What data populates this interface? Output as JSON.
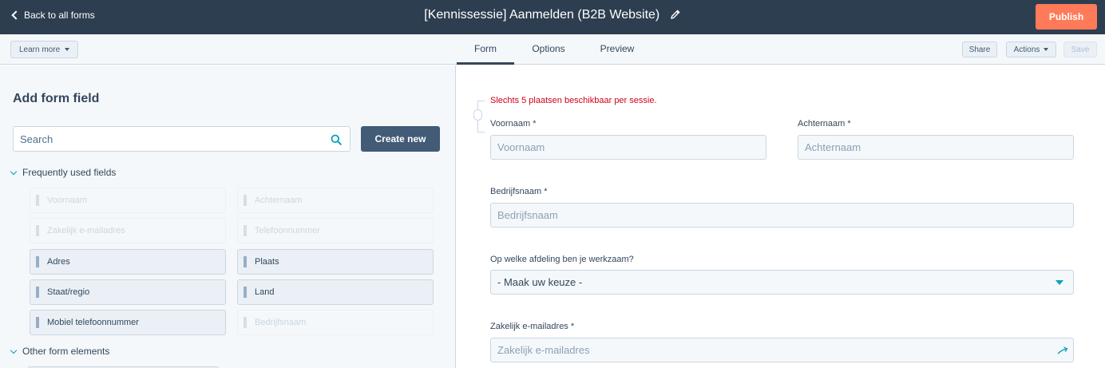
{
  "topbar": {
    "back_label": "Back to all forms",
    "title": "[Kennissessie] Aanmelden (B2B Website)",
    "publish_label": "Publish"
  },
  "subbar": {
    "learn_more": "Learn more",
    "tabs": [
      {
        "label": "Form",
        "active": true
      },
      {
        "label": "Options",
        "active": false
      },
      {
        "label": "Preview",
        "active": false
      }
    ],
    "share": "Share",
    "actions": "Actions",
    "save": "Save"
  },
  "left": {
    "title": "Add form field",
    "search_placeholder": "Search",
    "create_new": "Create new",
    "frequently_used": "Frequently used fields",
    "fields": [
      {
        "label": "Voornaam",
        "enabled": false
      },
      {
        "label": "Achternaam",
        "enabled": false
      },
      {
        "label": "Zakelijk e-mailadres",
        "enabled": false
      },
      {
        "label": "Telefoonnummer",
        "enabled": false
      },
      {
        "label": "Adres",
        "enabled": true
      },
      {
        "label": "Plaats",
        "enabled": true
      },
      {
        "label": "Staat/regio",
        "enabled": true
      },
      {
        "label": "Land",
        "enabled": true
      },
      {
        "label": "Mobiel telefoonnummer",
        "enabled": true
      },
      {
        "label": "Bedrijfsnaam",
        "enabled": false
      }
    ],
    "other_elements": "Other form elements"
  },
  "form": {
    "notice": "Slechts 5 plaatsen beschikbaar per sessie.",
    "voornaam_label": "Voornaam *",
    "voornaam_placeholder": "Voornaam",
    "achternaam_label": "Achternaam *",
    "achternaam_placeholder": "Achternaam",
    "bedrijfsnaam_label": "Bedrijfsnaam *",
    "bedrijfsnaam_placeholder": "Bedrijfsnaam",
    "afdeling_label": "Op welke afdeling ben je werkzaam?",
    "afdeling_value": "- Maak uw keuze -",
    "email_label": "Zakelijk e-mailadres *",
    "email_placeholder": "Zakelijk e-mailadres"
  },
  "colors": {
    "topbar": "#2d3e50",
    "publish": "#ff7a59",
    "accent": "#00a4bd",
    "notice": "#d0021b"
  }
}
